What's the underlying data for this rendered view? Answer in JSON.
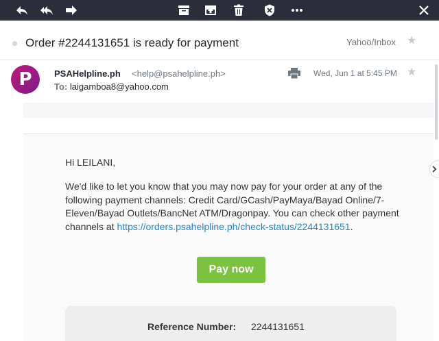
{
  "toolbar": {
    "icons": [
      "reply-icon",
      "reply-all-icon",
      "forward-icon",
      "archive-icon",
      "move-icon",
      "delete-icon",
      "spam-icon",
      "more-icon",
      "close-icon"
    ],
    "bg_color": "#2b2e3a"
  },
  "message": {
    "subject": "Order #2244131651 is ready for payment",
    "folder": "Yahoo/Inbox",
    "sender_name": "PSAHelpline.ph",
    "sender_email": "<help@psahelpline.ph>",
    "to_label": "To:",
    "to_address": "laigamboa8@yahoo.com",
    "date": "Wed, Jun 1 at 5:45 PM",
    "avatar_letter": "P"
  },
  "body": {
    "greeting": "Hi LEILANI,",
    "text": "We'd like to let you know that you may now pay for your order at any of the following payment channels: Credit Card/GCash/PayMaya/Bayad Online/7-Eleven/Bayad Outlets/BancNet ATM/Dragonpay. You can check other payment channels at ",
    "link_text": "https://orders.psahelpline.ph/check-status/2244131651",
    "text_after_link": ".",
    "pay_button_label": "Pay now",
    "reference_label": "Reference Number:",
    "reference_value": "2244131651"
  },
  "colors": {
    "accent_green": "#7cc241",
    "link_blue": "#1e88c9"
  }
}
